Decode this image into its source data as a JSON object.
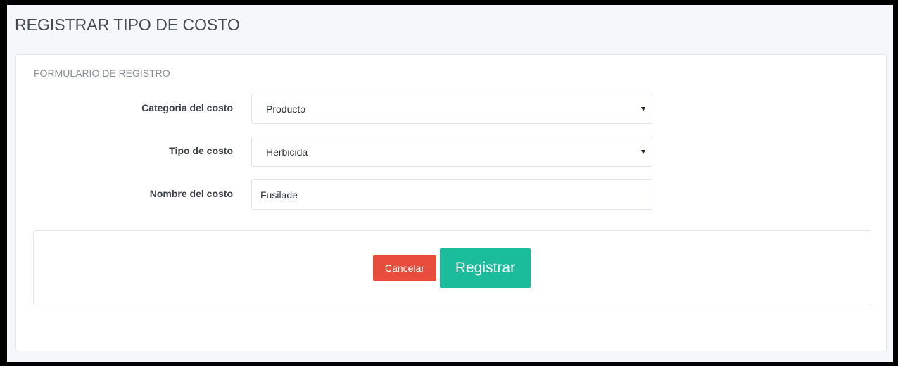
{
  "page": {
    "title": "REGISTRAR TIPO DE COSTO"
  },
  "form": {
    "heading": "FORMULARIO DE REGISTRO",
    "fields": {
      "categoria": {
        "label": "Categoria del costo",
        "value": "Producto"
      },
      "tipo": {
        "label": "Tipo de costo",
        "value": "Herbicida"
      },
      "nombre": {
        "label": "Nombre del costo",
        "value": "Fusilade"
      }
    }
  },
  "actions": {
    "cancel_label": "Cancelar",
    "register_label": "Registrar"
  },
  "colors": {
    "cancel": "#e74c3c",
    "register": "#1abc9c"
  }
}
